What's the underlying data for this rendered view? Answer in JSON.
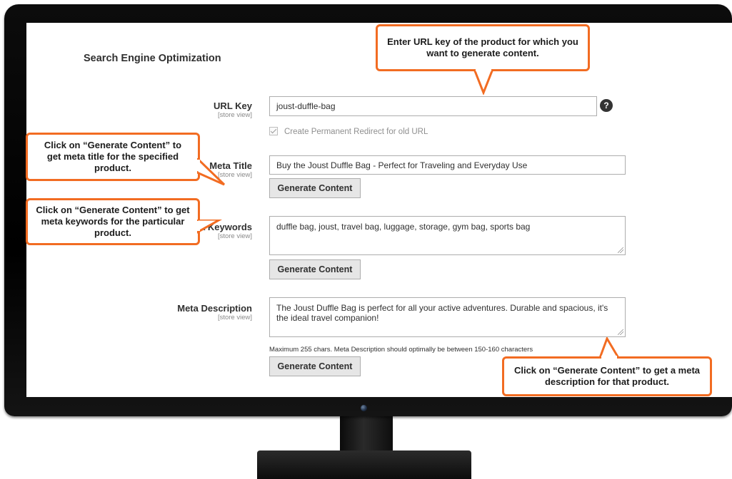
{
  "seo_panel": {
    "section_title": "Search Engine Optimization",
    "url_key": {
      "label": "URL Key",
      "scope": "[store view]",
      "value": "joust-duffle-bag",
      "help_icon": "question-circle-icon",
      "help_text": "?"
    },
    "redirect_checkbox": {
      "label": "Create Permanent Redirect for old URL",
      "checked": true
    },
    "meta_title": {
      "label": "Meta Title",
      "scope": "[store view]",
      "value": "Buy the Joust Duffle Bag - Perfect for Traveling and Everyday Use",
      "button": "Generate Content"
    },
    "meta_keywords": {
      "label": "Meta Keywords",
      "scope": "[store view]",
      "value": "duffle bag, joust, travel bag, luggage, storage, gym bag, sports bag",
      "button": "Generate Content"
    },
    "meta_description": {
      "label": "Meta Description",
      "scope": "[store view]",
      "value": "The Joust Duffle Bag is perfect for all your active adventures. Durable and spacious, it's the ideal travel companion!",
      "note": "Maximum 255 chars. Meta Description should optimally be between 150-160 characters",
      "button": "Generate Content"
    }
  },
  "callouts": {
    "url_key": "Enter URL key of the product for which you want to generate content.",
    "meta_title": "Click on “Generate Content” to get meta title for the specified product.",
    "meta_keywords": "Click on “Generate Content” to get meta keywords for the particular product.",
    "meta_description": "Click on “Generate Content” to get a meta description for that product."
  },
  "colors": {
    "callout_border": "#f26c22",
    "button_bg": "#e6e6e6",
    "input_border": "#adadad",
    "bezel": "#000000"
  }
}
